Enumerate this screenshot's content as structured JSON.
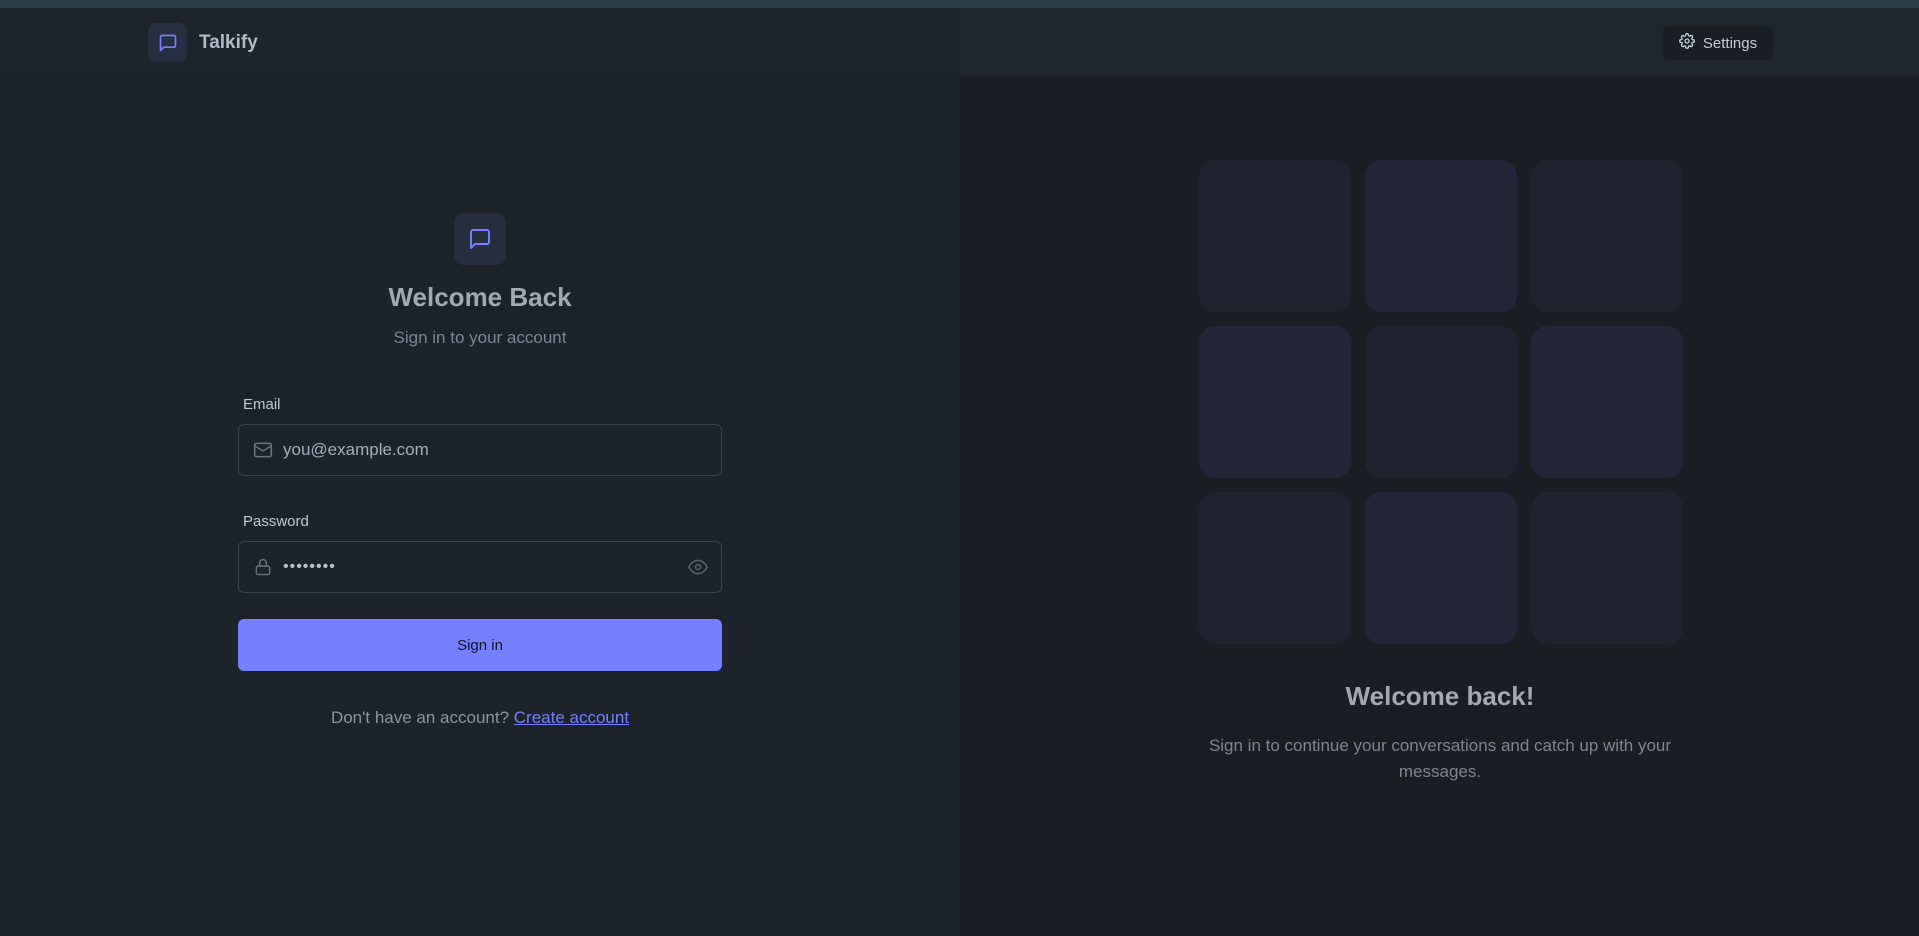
{
  "header": {
    "brand_name": "Talkify",
    "settings_label": "Settings"
  },
  "login": {
    "title": "Welcome Back",
    "subtitle": "Sign in to your account",
    "email": {
      "label": "Email",
      "placeholder": "you@example.com"
    },
    "password": {
      "label": "Password",
      "value": "••••••••"
    },
    "submit_label": "Sign in",
    "signup_prompt": "Don't have an account?",
    "signup_link": "Create account"
  },
  "hero": {
    "title": "Welcome back!",
    "text": "Sign in to continue your conversations and catch up with your messages."
  },
  "colors": {
    "accent": "#7480ff",
    "background": "#1d232a",
    "panel": "#1a1e24"
  },
  "icons": {
    "brand": "message-square-icon",
    "settings": "gear-icon",
    "email": "mail-icon",
    "password": "lock-icon",
    "reveal": "eye-icon"
  }
}
